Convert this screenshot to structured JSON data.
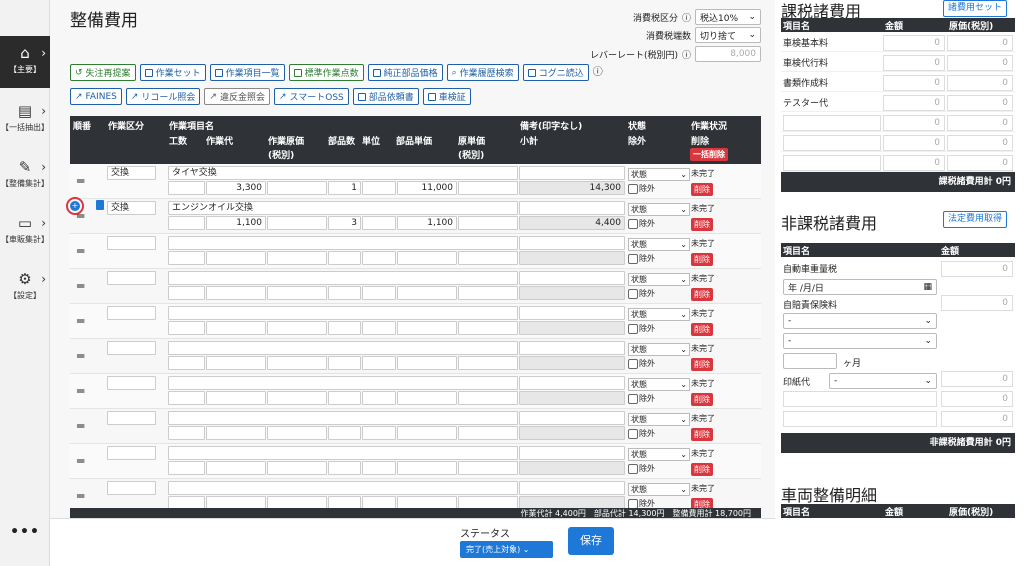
{
  "sidebar": {
    "items": [
      {
        "label": "【主要】",
        "icon": "home-icon"
      },
      {
        "label": "【一括抽出】",
        "icon": "file-export-icon"
      },
      {
        "label": "【整備集計】",
        "icon": "wrench-icon"
      },
      {
        "label": "【車販集計】",
        "icon": "car-icon"
      },
      {
        "label": "【設定】",
        "icon": "gear-icon"
      }
    ],
    "more": "•••"
  },
  "main": {
    "title": "整備費用",
    "tax_category_label": "消費税区分",
    "tax_category_value": "税込10%",
    "tax_rounding_label": "消費税端数",
    "tax_rounding_value": "切り捨て",
    "labor_rate_label": "レバーレート(税別円)",
    "labor_rate_placeholder": "8,000",
    "buttons_row1": [
      "失注再提案",
      "作業セット",
      "作業項目一覧",
      "標準作業点数",
      "純正部品価格",
      "作業履歴検索",
      "コグニ読込"
    ],
    "buttons_row2": [
      "FAINES",
      "リコール照会",
      "違反金照会",
      "スマートOSS",
      "部品依頼書",
      "車検証"
    ]
  },
  "grid": {
    "headers": {
      "order": "順番",
      "work_type": "作業区分",
      "work_item": "作業項目名",
      "hours": "工数",
      "labor": "作業代",
      "labor_cost": "作業原価",
      "labor_cost_sub": "(税別)",
      "parts_qty": "部品数",
      "unit": "単位",
      "parts_price": "部品単価",
      "cost_price": "原単価",
      "cost_price_sub": "(税別)",
      "notes": "備考(印字なし)",
      "subtotal": "小計",
      "state": "状態",
      "exclude": "除外",
      "work_status": "作業状況",
      "delete": "削除",
      "bulk_delete": "一括削除"
    },
    "rows": [
      {
        "type": "交換",
        "item": "タイヤ交換",
        "labor": "3,300",
        "qty": "1",
        "price": "11,000",
        "subtotal": "14,300"
      },
      {
        "type": "交換",
        "item": "エンジンオイル交換",
        "labor": "1,100",
        "qty": "3",
        "price": "1,100",
        "subtotal": "4,400"
      },
      {
        "type": "",
        "item": "",
        "labor": "",
        "qty": "",
        "price": "",
        "subtotal": ""
      },
      {
        "type": "",
        "item": "",
        "labor": "",
        "qty": "",
        "price": "",
        "subtotal": ""
      },
      {
        "type": "",
        "item": "",
        "labor": "",
        "qty": "",
        "price": "",
        "subtotal": ""
      },
      {
        "type": "",
        "item": "",
        "labor": "",
        "qty": "",
        "price": "",
        "subtotal": ""
      },
      {
        "type": "",
        "item": "",
        "labor": "",
        "qty": "",
        "price": "",
        "subtotal": ""
      },
      {
        "type": "",
        "item": "",
        "labor": "",
        "qty": "",
        "price": "",
        "subtotal": ""
      },
      {
        "type": "",
        "item": "",
        "labor": "",
        "qty": "",
        "price": "",
        "subtotal": ""
      },
      {
        "type": "",
        "item": "",
        "labor": "",
        "qty": "",
        "price": "",
        "subtotal": ""
      }
    ],
    "state_label": "状態",
    "exclude_label": "除外",
    "incomplete_label": "未完了",
    "delete_label": "削除",
    "footer_total": "作業代計 4,400円　部品代計 14,300円　整備費用計 18,700円"
  },
  "bottom": {
    "status_label": "ステータス",
    "status_value": "完了(売上対象)",
    "save_label": "保存"
  },
  "taxable": {
    "title": "課税諸費用",
    "set_button": "諸費用セット",
    "col_name": "項目名",
    "col_amount": "金額",
    "col_cost": "原価(税別)",
    "items": [
      "車検基本料",
      "車検代行料",
      "書類作成料",
      "テスター代",
      "",
      "",
      ""
    ],
    "zero": "0",
    "total": "課税諸費用計 0円"
  },
  "nontaxable": {
    "title": "非課税諸費用",
    "fetch_button": "法定費用取得",
    "col_name": "項目名",
    "col_amount": "金額",
    "weight_tax": "自動車重量税",
    "date_placeholder": "年 /月/日",
    "insurance": "自賠責保険料",
    "dash": "-",
    "months": "ヶ月",
    "stamp": "印紙代",
    "zero": "0",
    "total": "非課税諸費用計 0円"
  },
  "vehicle": {
    "title": "車両整備明細",
    "col_name": "項目名",
    "col_amount": "金額",
    "col_cost": "原価(税別)"
  }
}
